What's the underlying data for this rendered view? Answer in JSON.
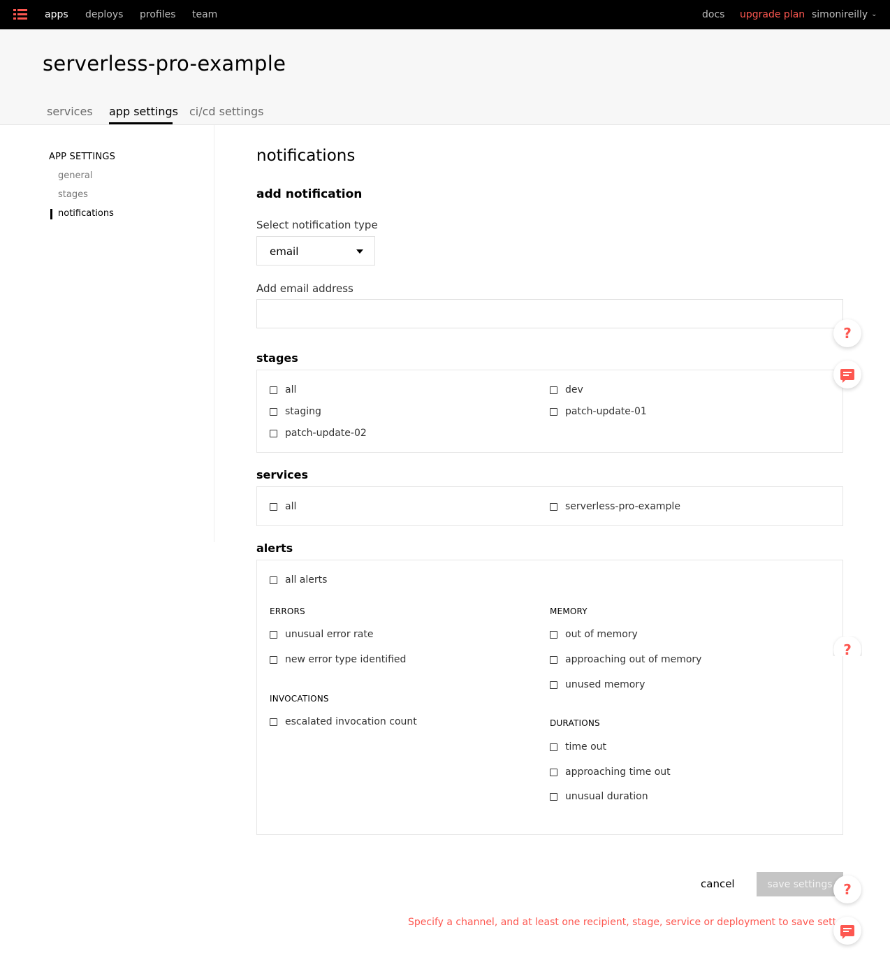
{
  "nav": {
    "links": [
      "apps",
      "deploys",
      "profiles",
      "team"
    ],
    "docs": "docs",
    "upgrade": "upgrade plan",
    "user": "simonireilly"
  },
  "header": {
    "title": "serverless-pro-example",
    "tabs": [
      "services",
      "app settings",
      "ci/cd settings"
    ],
    "active_tab": "app settings"
  },
  "sidebar": {
    "heading": "APP SETTINGS",
    "items": [
      "general",
      "stages",
      "notifications"
    ],
    "active": "notifications"
  },
  "main": {
    "title": "notifications",
    "subtitle": "add notification",
    "type_label": "Select notification type",
    "type_value": "email",
    "email_label": "Add email address",
    "email_value": "",
    "stages": {
      "heading": "stages",
      "options": [
        "all",
        "dev",
        "staging",
        "patch-update-01",
        "patch-update-02"
      ]
    },
    "services": {
      "heading": "services",
      "options": [
        "all",
        "serverless-pro-example"
      ]
    },
    "alerts": {
      "heading": "alerts",
      "all": "all alerts",
      "errors": {
        "heading": "ERRORS",
        "options": [
          "unusual error rate",
          "new error type identified"
        ]
      },
      "invocations": {
        "heading": "INVOCATIONS",
        "options": [
          "escalated invocation count"
        ]
      },
      "memory": {
        "heading": "MEMORY",
        "options": [
          "out of memory",
          "approaching out of memory",
          "unused memory"
        ]
      },
      "durations": {
        "heading": "DURATIONS",
        "options": [
          "time out",
          "approaching time out",
          "unusual duration"
        ]
      }
    }
  },
  "footer": {
    "cancel": "cancel",
    "save": "save settings",
    "error": "Specify a channel, and at least one recipient, stage, service or deployment to save settings"
  },
  "helpers": {
    "help_glyph": "?",
    "help_icon": "question-icon",
    "chat_icon": "chat-icon"
  },
  "colors": {
    "accent": "#fd5750",
    "nav_bg": "#000000",
    "header_bg": "#f7f7f7",
    "disabled": "#c5c5c5"
  }
}
